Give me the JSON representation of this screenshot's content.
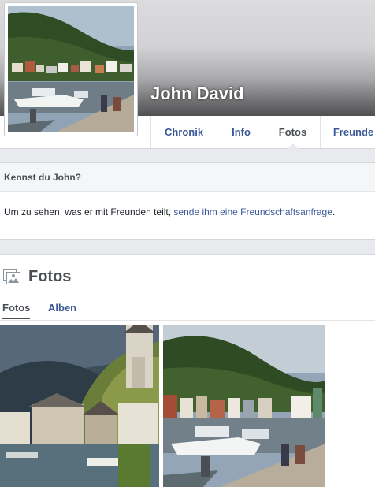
{
  "profile": {
    "name": "John David"
  },
  "tabs": [
    {
      "label": "Chronik",
      "active": false
    },
    {
      "label": "Info",
      "active": false
    },
    {
      "label": "Fotos",
      "active": true
    },
    {
      "label": "Freunde",
      "active": false
    }
  ],
  "know": {
    "heading": "Kennst du John?",
    "text": "Um zu sehen, was er mit Freunden teilt, ",
    "link": "sende ihm eine Freundschaftsanfrage",
    "suffix": "."
  },
  "photos": {
    "title": "Fotos",
    "icon": "photos-icon",
    "subtabs": [
      {
        "label": "Fotos",
        "active": true
      },
      {
        "label": "Alben",
        "active": false
      }
    ]
  },
  "colors": {
    "link": "#3b5998",
    "page_background": "#e9eaed"
  }
}
